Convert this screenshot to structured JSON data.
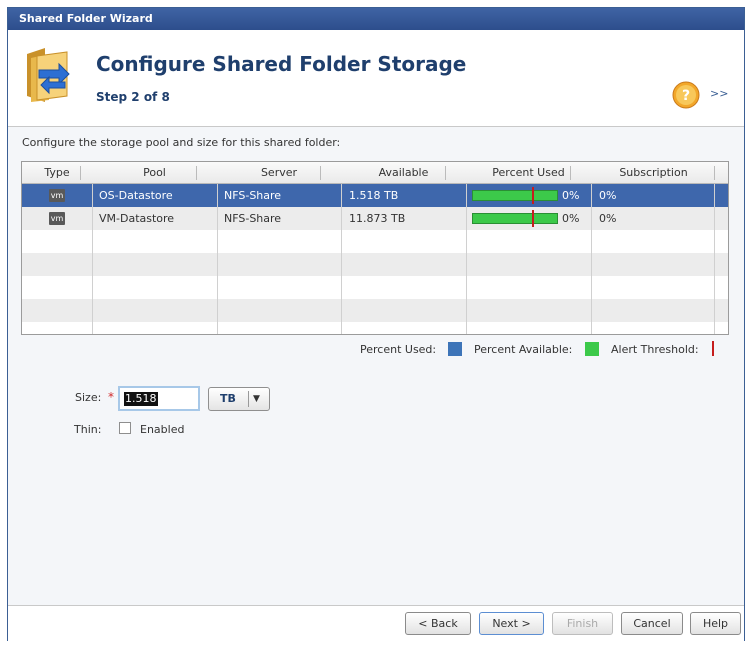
{
  "window": {
    "title": "Shared Folder Wizard"
  },
  "header": {
    "title": "Configure Shared Folder Storage",
    "step": "Step 2 of 8",
    "expand_label": ">>"
  },
  "content": {
    "instruction": "Configure the storage pool and size for this shared folder:",
    "table": {
      "columns": [
        "Type",
        "Pool",
        "Server",
        "Available",
        "Percent Used",
        "Subscription"
      ],
      "rows": [
        {
          "type": "vm",
          "pool": "OS-Datastore",
          "server": "NFS-Share",
          "available": "1.518 TB",
          "percent_used": "0%",
          "percent_used_value": 0,
          "subscription": "0%",
          "selected": true
        },
        {
          "type": "vm",
          "pool": "VM-Datastore",
          "server": "NFS-Share",
          "available": "11.873 TB",
          "percent_used": "0%",
          "percent_used_value": 0,
          "subscription": "0%",
          "selected": false
        }
      ]
    },
    "legend": {
      "used_label": "Percent Used:",
      "available_label": "Percent Available:",
      "threshold_label": "Alert Threshold:",
      "used_color": "#3d74b8",
      "available_color": "#3cc94a",
      "threshold_color": "#c51d1d"
    },
    "size": {
      "label": "Size:",
      "required_mark": "*",
      "value": "1.518",
      "unit": "TB",
      "unit_arrow": "▼"
    },
    "thin": {
      "label": "Thin:",
      "checkbox_label": "Enabled",
      "checked": false
    }
  },
  "footer": {
    "back_label": "< Back",
    "next_label": "Next >",
    "finish_label": "Finish",
    "cancel_label": "Cancel",
    "help_label": "Help"
  }
}
